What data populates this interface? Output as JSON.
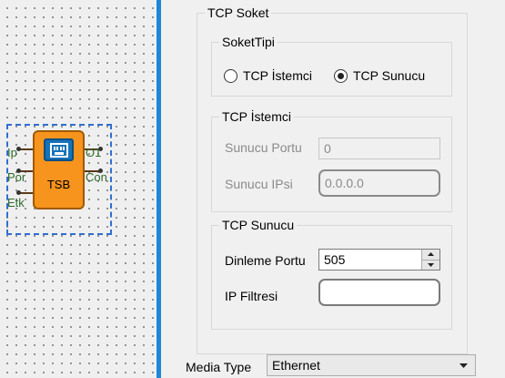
{
  "block": {
    "name": "TSB",
    "ports_left": [
      "Ip",
      "Por",
      "Etk"
    ],
    "ports_right": [
      "O1",
      "Con"
    ]
  },
  "tcp_socket": {
    "title": "TCP Soket",
    "socket_type": {
      "title": "SoketTipi",
      "options": [
        {
          "label": "TCP İstemci",
          "selected": false
        },
        {
          "label": "TCP Sunucu",
          "selected": true
        }
      ]
    },
    "client": {
      "title": "TCP İstemci",
      "server_port_label": "Sunucu Portu",
      "server_port_value": "0",
      "server_ip_label": "Sunucu IPsi",
      "server_ip_value": "0.0.0.0"
    },
    "server": {
      "title": "TCP Sunucu",
      "listen_port_label": "Dinleme Portu",
      "listen_port_value": "505",
      "ip_filter_label": "IP Filtresi",
      "ip_filter_value": ""
    }
  },
  "media_type": {
    "label": "Media Type",
    "value": "Ethernet"
  },
  "colors": {
    "block_fill": "#f7941d",
    "icon_fill": "#1673b9",
    "selection_border": "#2f6fd0",
    "splitter": "#1f86d8"
  }
}
